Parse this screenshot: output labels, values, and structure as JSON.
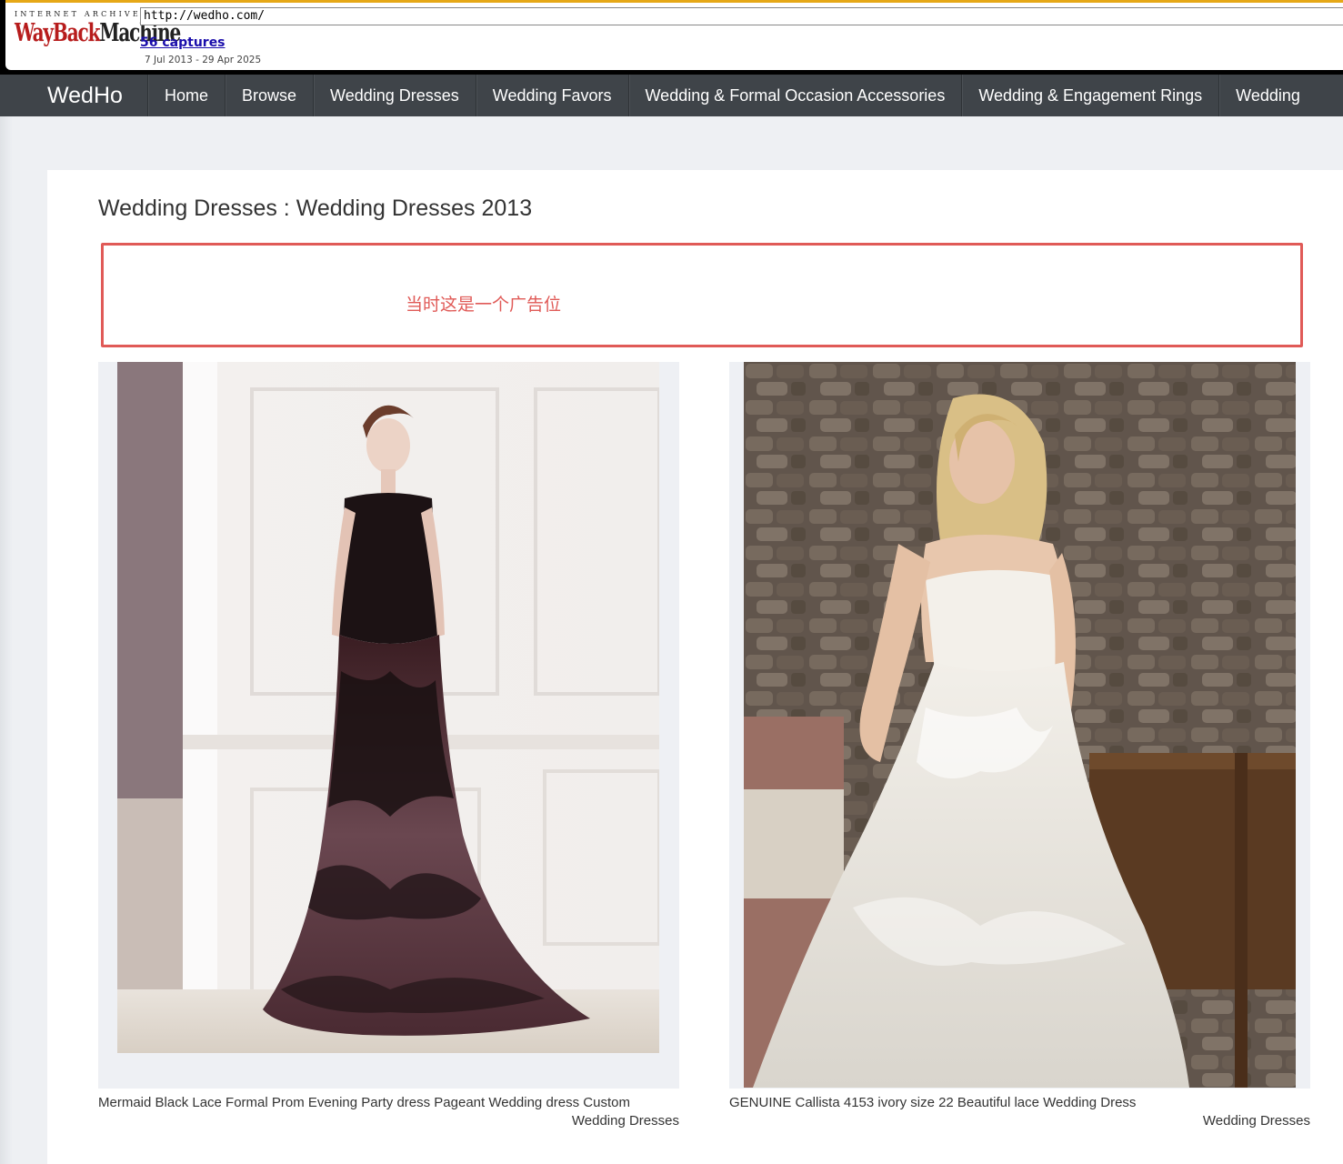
{
  "wayback": {
    "logo_top": "INTERNET ARCHIVE",
    "logo_main_a": "WayBack",
    "logo_main_b": "Machine",
    "url": "http://wedho.com/",
    "captures": "56 captures",
    "range": "7 Jul 2013 - 29 Apr 2025"
  },
  "nav": {
    "brand": "WedHo",
    "items": [
      {
        "label": "Home"
      },
      {
        "label": "Browse"
      },
      {
        "label": "Wedding Dresses"
      },
      {
        "label": "Wedding Favors"
      },
      {
        "label": "Wedding & Formal Occasion Accessories"
      },
      {
        "label": "Wedding & Engagement Rings"
      },
      {
        "label": "Wedding"
      }
    ]
  },
  "page": {
    "title": "Wedding Dresses : Wedding Dresses 2013",
    "ad_note": "当时这是一个广告位"
  },
  "products": [
    {
      "caption": "Mermaid Black Lace Formal Prom Evening Party dress Pageant Wedding dress Custom",
      "category": "Wedding Dresses",
      "image": "black-lace-mermaid-dress-photo"
    },
    {
      "caption": "GENUINE Callista 4153 ivory size 22 Beautiful lace Wedding Dress",
      "category": "Wedding Dresses",
      "image": "ivory-lace-wedding-dress-photo"
    }
  ],
  "colors": {
    "nav_bg": "#3f4449",
    "ad_border": "#e05a57",
    "wayback_red": "#b71c1c",
    "link_blue": "#1a0dab"
  }
}
